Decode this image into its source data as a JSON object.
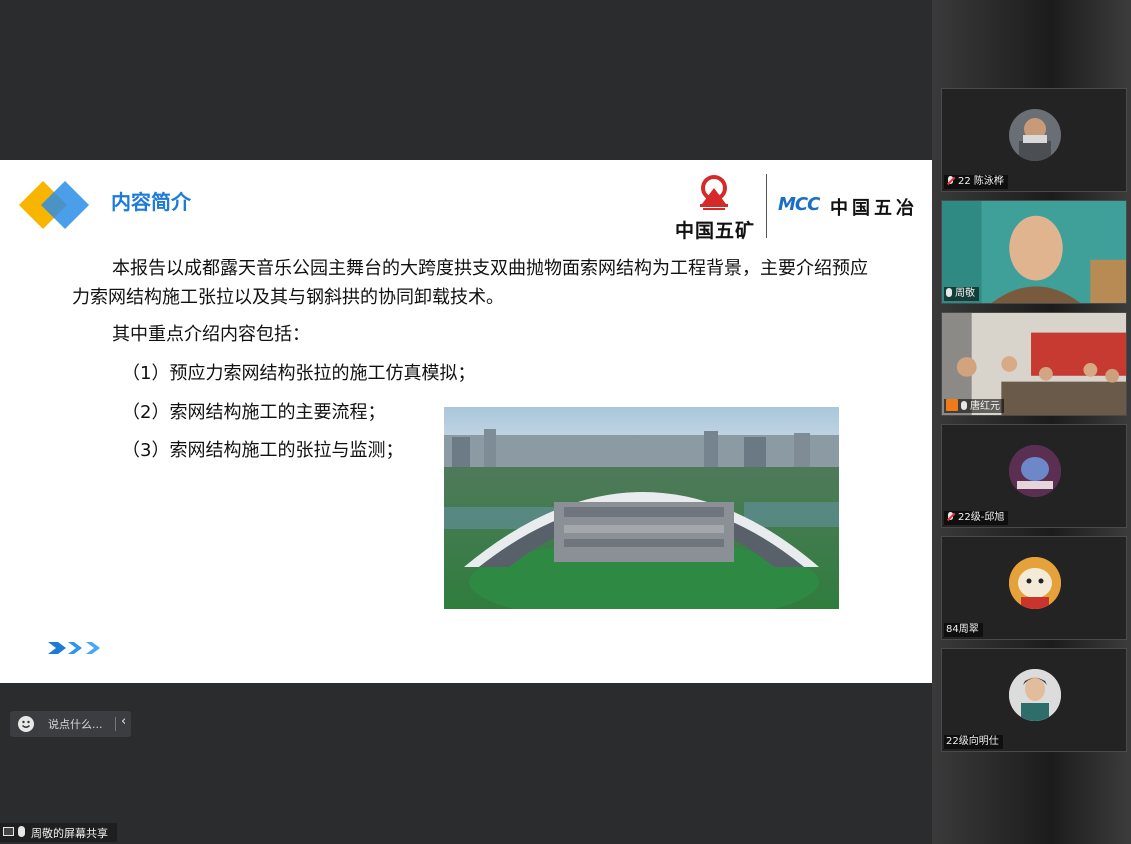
{
  "slide": {
    "title": "内容简介",
    "logo_minmetals_text": "中国五矿",
    "logo_mcc_mark": "MCC",
    "logo_mcc_text": "中国五冶",
    "paragraph": "本报告以成都露天音乐公园主舞台的大跨度拱支双曲抛物面索网结构为工程背景，主要介绍预应力索网结构施工张拉以及其与钢斜拱的协同卸载技术。",
    "sub_intro": "其中重点介绍内容包括：",
    "items": [
      "（1）预应力索网结构张拉的施工仿真模拟；",
      "（2）索网结构施工的主要流程；",
      "（3）索网结构施工的张拉与监测；"
    ],
    "photo_icon": "stadium-aerial-photo",
    "nav_icon": "triple-chevron-right-icon"
  },
  "chat": {
    "placeholder": "说点什么...",
    "emoji_icon": "smiley-icon",
    "collapse_icon": "chevron-left-icon"
  },
  "share": {
    "label": "周敬的屏幕共享"
  },
  "participants": [
    {
      "name": "22 陈泳桦",
      "mic": "muted"
    },
    {
      "name": "周敬",
      "mic": "on"
    },
    {
      "name": "唐红元",
      "mic": "on",
      "host": true
    },
    {
      "name": "22级-邱旭",
      "mic": "muted"
    },
    {
      "name": "84周翠",
      "mic": "none"
    },
    {
      "name": "22级向明仕",
      "mic": "none"
    }
  ],
  "colors": {
    "accent_blue": "#1d7bd8",
    "diamond_yellow": "#f7b500",
    "background": "#2b2c2e"
  }
}
